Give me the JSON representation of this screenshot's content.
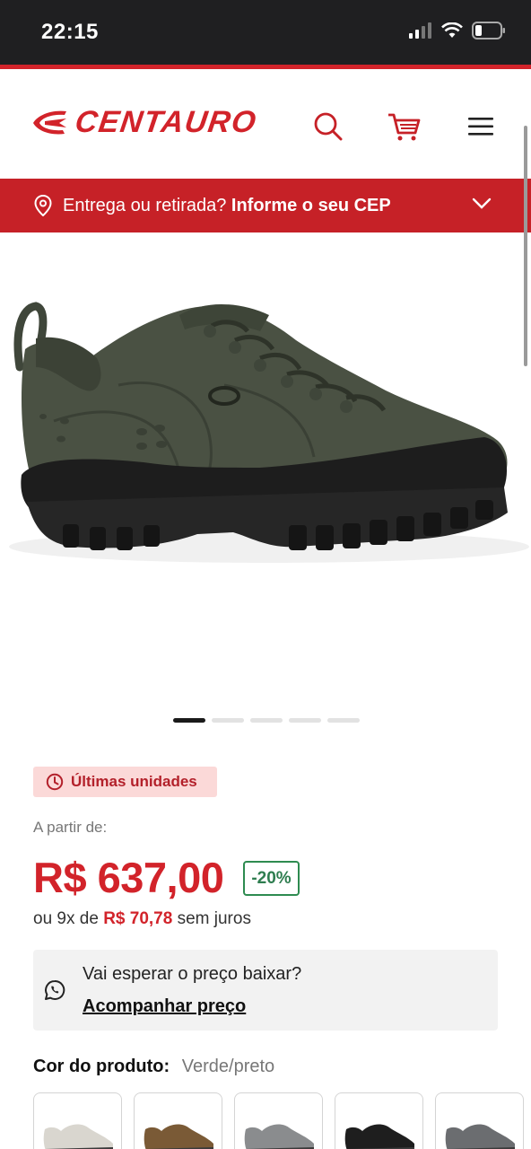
{
  "status_bar": {
    "time": "22:15"
  },
  "header": {
    "logo_text": "CENTAURO",
    "search_icon": "search-icon",
    "cart_icon": "cart-icon",
    "menu_icon": "menu-icon"
  },
  "delivery": {
    "prefix": "Entrega ou retirada?",
    "cta": "Informe o seu CEP"
  },
  "product": {
    "image_alt": "Tênis Oakley verde/preto",
    "carousel_total": 5,
    "carousel_active": 1,
    "badge": "Últimas unidades",
    "from_label": "A partir de:",
    "price": "R$ 637,00",
    "discount": "-20%",
    "installments_prefix": "ou 9x de",
    "installments_value": "R$ 70,78",
    "installments_suffix": "sem juros",
    "price_alert_question": "Vai esperar o preço baixar?",
    "price_alert_link": "Acompanhar preço",
    "color_label": "Cor do produto:",
    "color_value": "Verde/preto",
    "swatches": [
      {
        "name": "Off white",
        "color": "#d9d6cf"
      },
      {
        "name": "Marrom",
        "color": "#7a5a36"
      },
      {
        "name": "Cinza",
        "color": "#8a8c8e"
      },
      {
        "name": "Preto",
        "color": "#1e1e1e"
      },
      {
        "name": "Cinza escuro",
        "color": "#6b6d70"
      }
    ]
  },
  "colors": {
    "brand_red": "#d2232a",
    "delivery_red": "#c62127",
    "discount_green": "#2e7d4f",
    "shoe_olive": "#4a5143"
  }
}
